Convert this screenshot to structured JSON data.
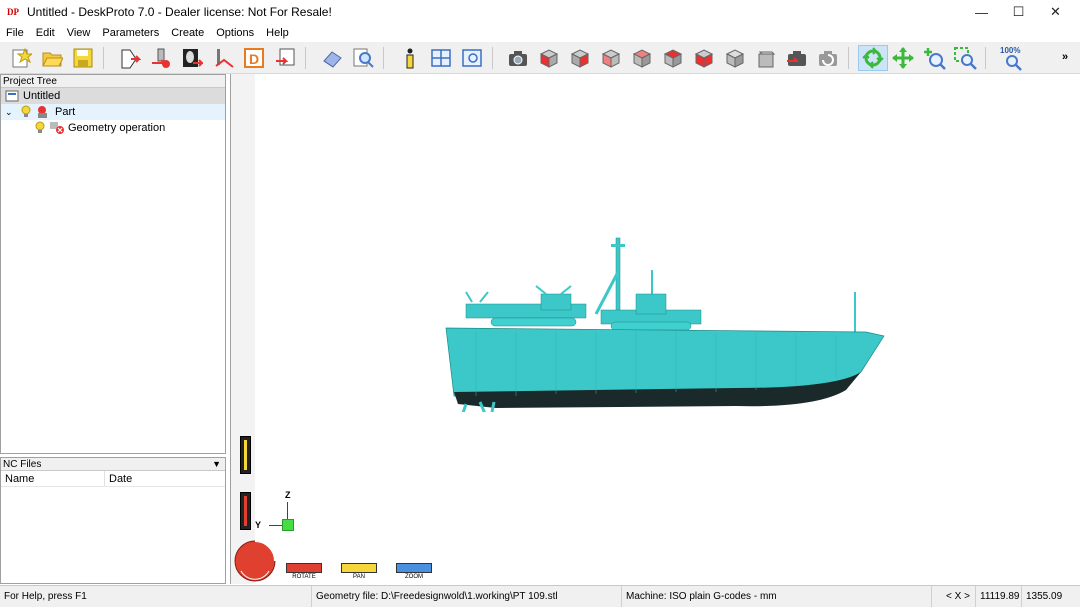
{
  "window": {
    "app_icon": "DP",
    "title": "Untitled - DeskProto 7.0 - Dealer license: Not For Resale!",
    "minimize": "—",
    "maximize": "☐",
    "close": "✕"
  },
  "menu": [
    "File",
    "Edit",
    "View",
    "Parameters",
    "Create",
    "Options",
    "Help"
  ],
  "toolbar": {
    "zoom_label": "100%",
    "more": "»",
    "icons": [
      "new-project-icon",
      "open-project-icon",
      "save-project-icon",
      "load-geometry-icon",
      "load-vector-icon",
      "load-bitmap-icon",
      "load-toolpath-icon",
      "dxf-icon",
      "export-icon",
      "eraser-icon",
      "preview-icon",
      "info-icon",
      "grid-view-icon",
      "window-view-icon",
      "camera-icon",
      "view-front-icon",
      "view-back-icon",
      "view-left-icon",
      "view-right-icon",
      "view-top-icon",
      "view-bottom-icon",
      "view-iso-icon",
      "view-iso2-icon",
      "snapshot-icon",
      "refresh-icon",
      "rotate-icon",
      "pan-icon",
      "zoom-in-icon",
      "zoom-window-icon",
      "zoom-100-icon"
    ],
    "colors": {
      "accent": "#e83232",
      "cube": "#b8b8b8",
      "yellow": "#f5d73b"
    }
  },
  "project_tree": {
    "header": "Project Tree",
    "root": "Untitled",
    "part": "Part",
    "operation": "Geometry operation"
  },
  "nc_files": {
    "header": "NC Files",
    "columns": [
      "Name",
      "Date"
    ]
  },
  "viewport": {
    "axis_z": "Z",
    "axis_y": "Y",
    "controls": [
      "ROTATE",
      "PAN",
      "ZOOM"
    ],
    "model_color": "#3cc8c8",
    "axis_cube_color": "#44dd44"
  },
  "statusbar": {
    "help": "For Help, press F1",
    "geometry": "Geometry file: D:\\Freedesignwold\\1.working\\PT 109.stl",
    "machine": "Machine: ISO plain G-codes - mm",
    "axis": "< X >",
    "coord1": "11119.89",
    "coord2": "1355.09"
  }
}
